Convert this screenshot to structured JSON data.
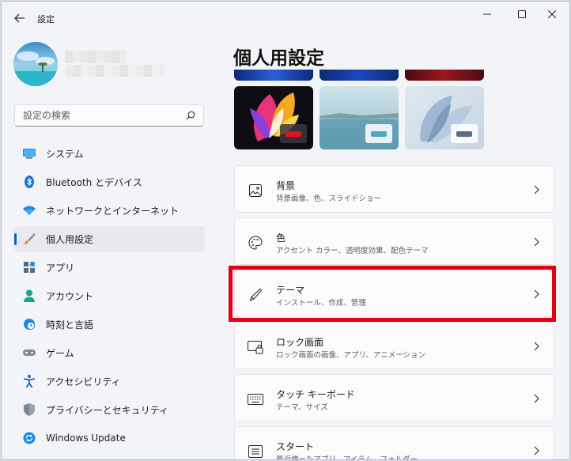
{
  "app": {
    "title": "設定"
  },
  "window_controls": {
    "minimize_icon": "minimize-icon",
    "maximize_icon": "maximize-icon",
    "close_icon": "close-icon"
  },
  "search": {
    "placeholder": "設定の検索"
  },
  "sidebar": {
    "items": [
      {
        "label": "システム",
        "icon": "monitor-icon"
      },
      {
        "label": "Bluetooth とデバイス",
        "icon": "bluetooth-icon"
      },
      {
        "label": "ネットワークとインターネット",
        "icon": "wifi-icon"
      },
      {
        "label": "個人用設定",
        "icon": "brush-icon",
        "selected": true
      },
      {
        "label": "アプリ",
        "icon": "apps-icon"
      },
      {
        "label": "アカウント",
        "icon": "person-icon"
      },
      {
        "label": "時刻と言語",
        "icon": "clock-globe-icon"
      },
      {
        "label": "ゲーム",
        "icon": "gamepad-icon"
      },
      {
        "label": "アクセシビリティ",
        "icon": "accessibility-icon"
      },
      {
        "label": "プライバシーとセキュリティ",
        "icon": "shield-icon"
      },
      {
        "label": "Windows Update",
        "icon": "update-icon"
      }
    ]
  },
  "main": {
    "title": "個人用設定",
    "settings": [
      {
        "title": "背景",
        "subtitle": "背景画像、色、スライドショー",
        "icon": "picture-icon"
      },
      {
        "title": "色",
        "subtitle": "アクセント カラー、透明度効果、配色テーマ",
        "icon": "palette-icon"
      },
      {
        "title": "テーマ",
        "subtitle": "インストール、作成、管理",
        "icon": "pen-icon"
      },
      {
        "title": "ロック画面",
        "subtitle": "ロック画面の画像、アプリ、アニメーション",
        "icon": "lock-screen-icon"
      },
      {
        "title": "タッチ キーボード",
        "subtitle": "テーマ、サイズ",
        "icon": "keyboard-icon"
      },
      {
        "title": "スタート",
        "subtitle": "最近使ったアプリ、アイテム、フォルダー",
        "icon": "start-icon"
      }
    ]
  },
  "colors": {
    "accent": "#0067c0",
    "highlight": "#e60012"
  }
}
